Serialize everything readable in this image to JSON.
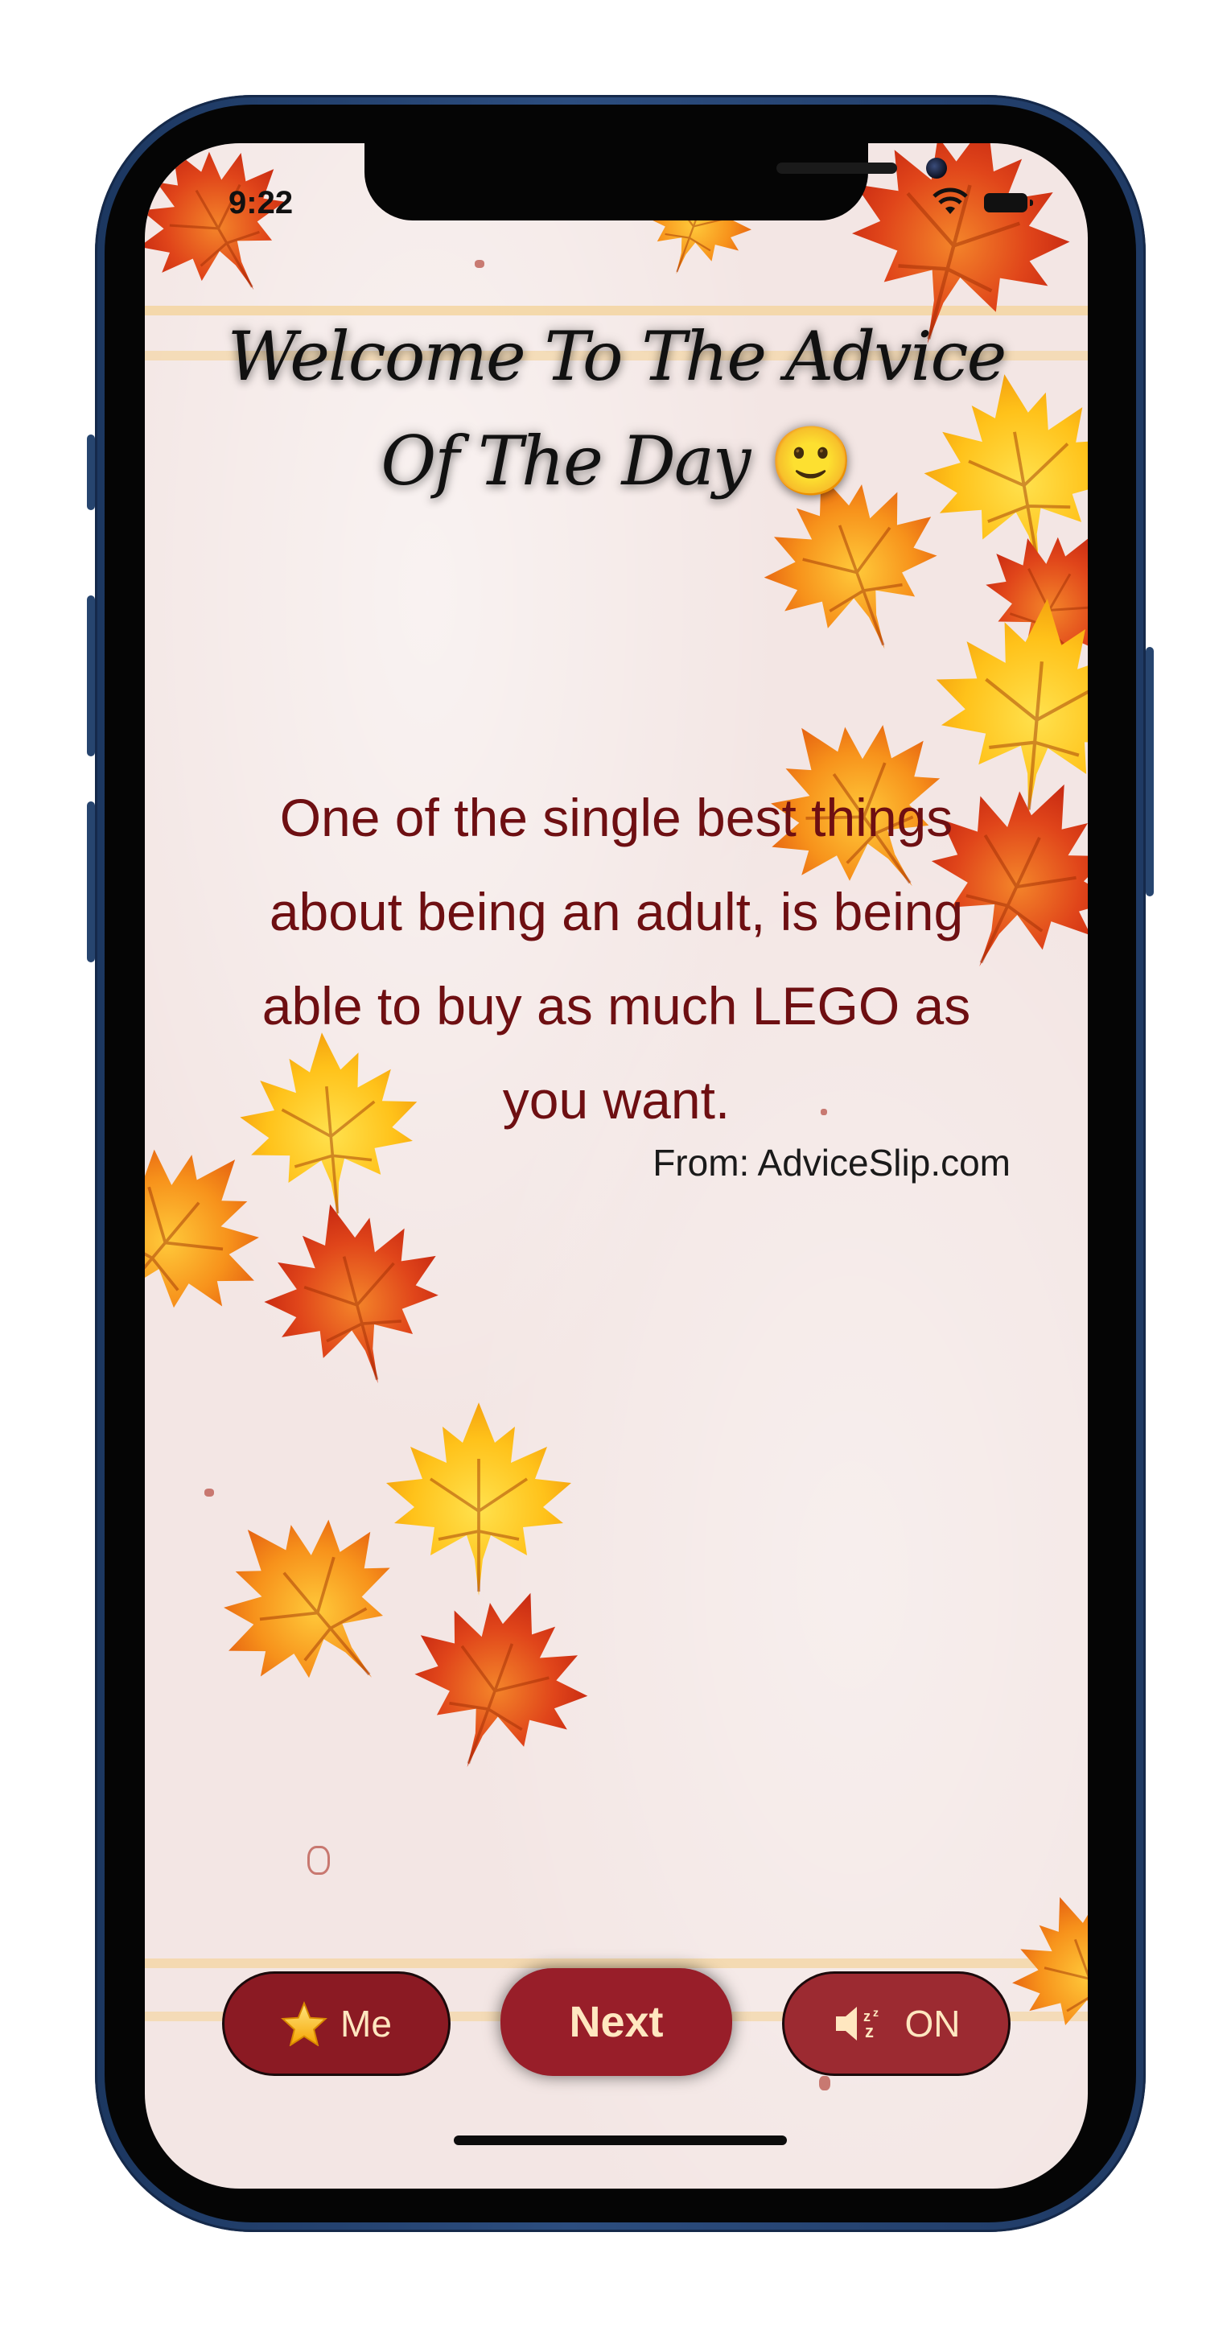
{
  "status_bar": {
    "time": "9:22"
  },
  "header": {
    "title_line1": "Welcome To The Advice",
    "title_line2": "Of The Day",
    "title_emoji": "🙂"
  },
  "advice": {
    "line1": "One of the single best things",
    "line2": "about being an adult, is being",
    "line3": "able to buy as much LEGO as",
    "line4": "you want.",
    "source": "From: AdviceSlip.com"
  },
  "buttons": {
    "me_label": "Me",
    "next_label": "Next",
    "sound_label": "ON"
  },
  "icons": {
    "me": "star-icon",
    "sound": "speaker-sleep-icon",
    "wifi": "wifi-icon",
    "battery": "battery-icon"
  },
  "colors": {
    "accent": "#8b1a23",
    "advice_text": "#6e0f12",
    "button_text": "#ffe7c0",
    "background": "#f3e6e4"
  }
}
